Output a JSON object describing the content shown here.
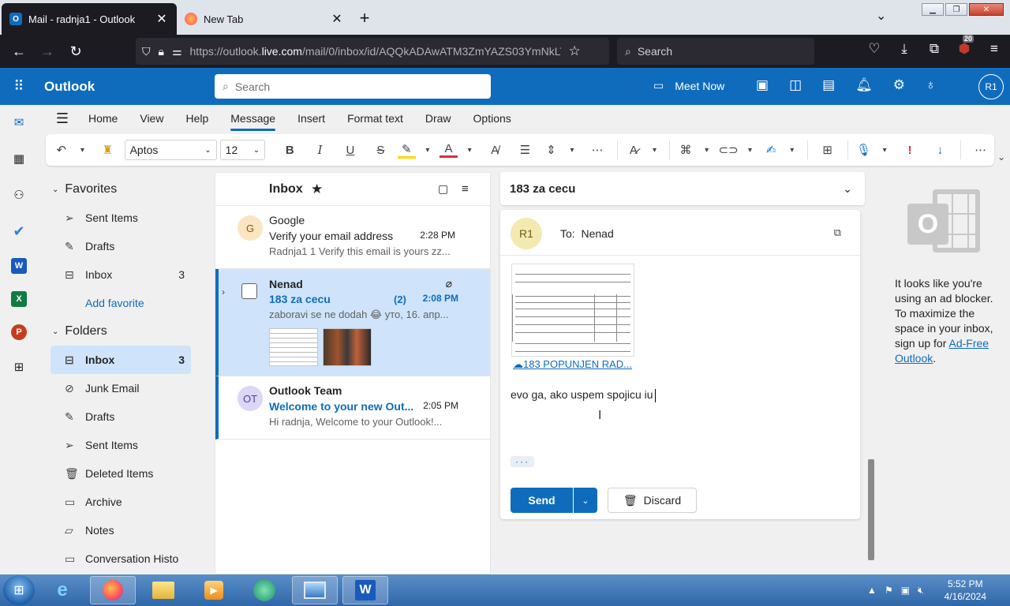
{
  "browser": {
    "tabs": [
      {
        "title": "Mail - radnja1 - Outlook",
        "active": true
      },
      {
        "title": "New Tab",
        "active": false
      }
    ],
    "url_prefix": "https://outlook.",
    "url_domain": "live.com",
    "url_rest": "/mail/0/inbox/id/AQQkADAwATM3ZmYAZS03YmNkLT",
    "search_placeholder": "Search",
    "extension_badge": "20"
  },
  "outlook": {
    "brand": "Outlook",
    "search_placeholder": "Search",
    "meet_now": "Meet Now",
    "avatar_initials": "R1",
    "ribbon_tabs": [
      "Home",
      "View",
      "Help",
      "Message",
      "Insert",
      "Format text",
      "Draw",
      "Options"
    ],
    "selected_ribbon_tab": "Message",
    "font_name": "Aptos",
    "font_size": "12"
  },
  "folders": {
    "favorites_header": "Favorites",
    "favorites": [
      {
        "label": "Sent Items",
        "count": ""
      },
      {
        "label": "Drafts",
        "count": ""
      },
      {
        "label": "Inbox",
        "count": "3"
      }
    ],
    "add_favorite": "Add favorite",
    "folders_header": "Folders",
    "items": [
      {
        "label": "Inbox",
        "count": "3"
      },
      {
        "label": "Junk Email",
        "count": ""
      },
      {
        "label": "Drafts",
        "count": ""
      },
      {
        "label": "Sent Items",
        "count": ""
      },
      {
        "label": "Deleted Items",
        "count": ""
      },
      {
        "label": "Archive",
        "count": ""
      },
      {
        "label": "Notes",
        "count": ""
      },
      {
        "label": "Conversation Histo",
        "count": ""
      }
    ]
  },
  "message_list": {
    "title": "Inbox",
    "messages": [
      {
        "avatar": "G",
        "from": "Google",
        "subject": "Verify your email address",
        "time": "2:28 PM",
        "preview": "Radnja1 1 Verify this email is yours zz..."
      },
      {
        "avatar": "",
        "from": "Nenad",
        "subject": "183 za cecu",
        "thread_count": "(2)",
        "time": "2:08 PM",
        "preview": "zaboravi se ne dodah 😂 уто, 16. апр..."
      },
      {
        "avatar": "OT",
        "from": "Outlook Team",
        "subject": "Welcome to your new Out...",
        "time": "2:05 PM",
        "preview": "Hi radnja, Welcome to your Outlook!..."
      }
    ]
  },
  "reading_pane": {
    "subject": "183 za cecu",
    "sender_initials": "R1",
    "to_label": "To:",
    "to_value": "Nenad",
    "attachment_name": "183 POPUNJEN RAD...",
    "body": "evo ga, ako uspem spojicu iu",
    "ellipsis": "···",
    "send": "Send",
    "discard": "Discard"
  },
  "adblock": {
    "text": "It looks like you're using an ad blocker. To maximize the space in your inbox, sign up for",
    "link": "Ad-Free Outlook",
    "end": "."
  },
  "taskbar": {
    "time": "5:52 PM",
    "date": "4/16/2024"
  },
  "colors": {
    "outlook_blue": "#0f6cbd",
    "selected_bg": "#cfe4fa",
    "browser_dark": "#1c1b22"
  }
}
